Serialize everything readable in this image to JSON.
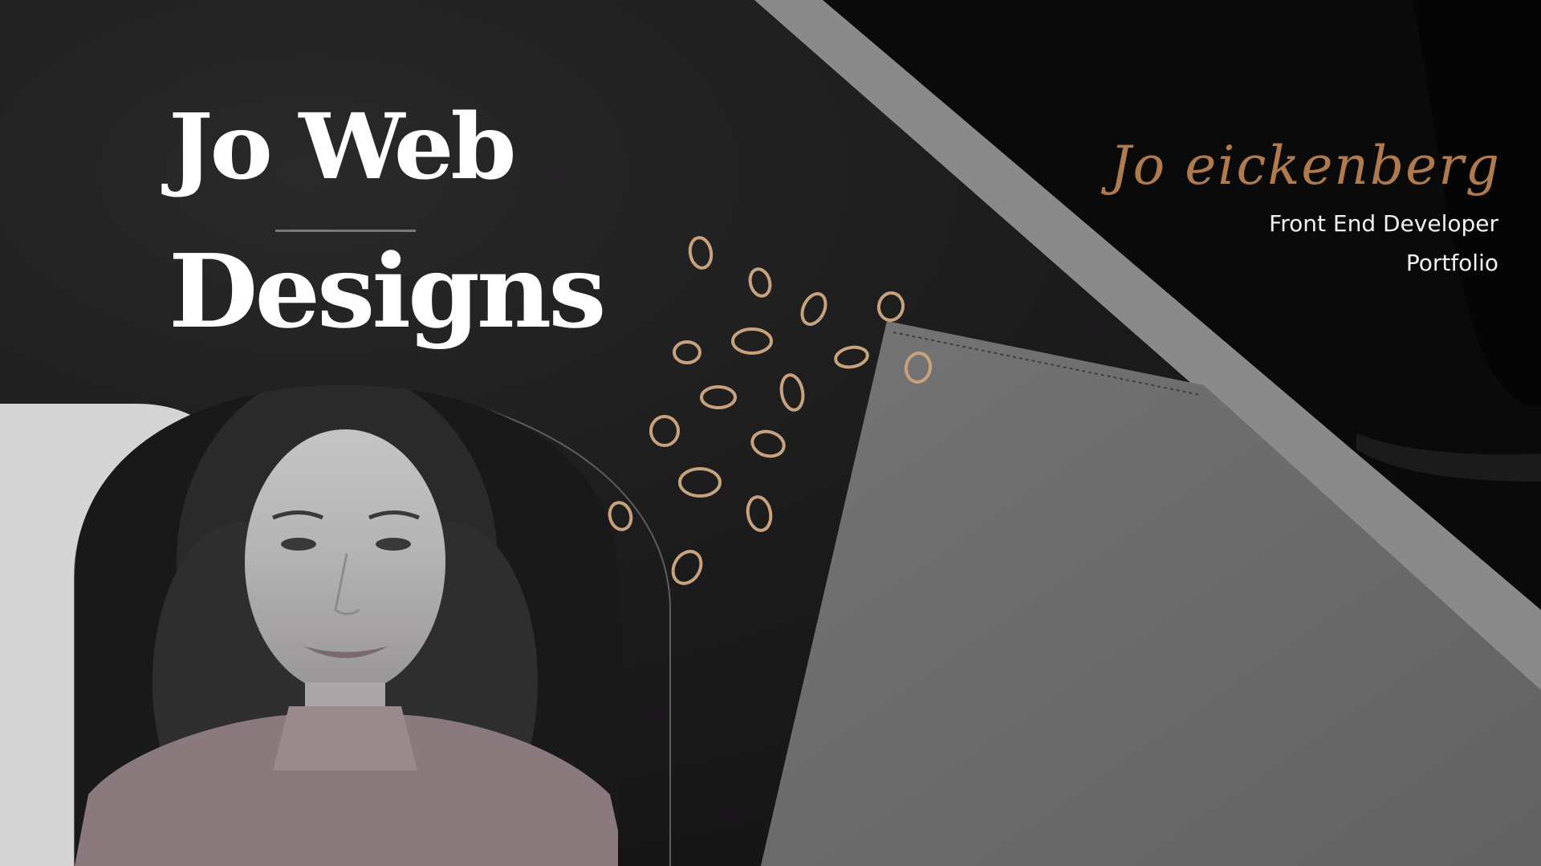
{
  "brand": {
    "line1": "Jo Web",
    "line2": "Designs"
  },
  "profile": {
    "name": "Jo eickenberg",
    "role": "Front End Developer",
    "subtitle": "Portfolio"
  },
  "colors": {
    "background": "#161516",
    "accent": "#b07a4f",
    "text": "#ffffff",
    "panel_gray": "#888888"
  },
  "images": {
    "portrait": "black-and-white portrait photo"
  }
}
